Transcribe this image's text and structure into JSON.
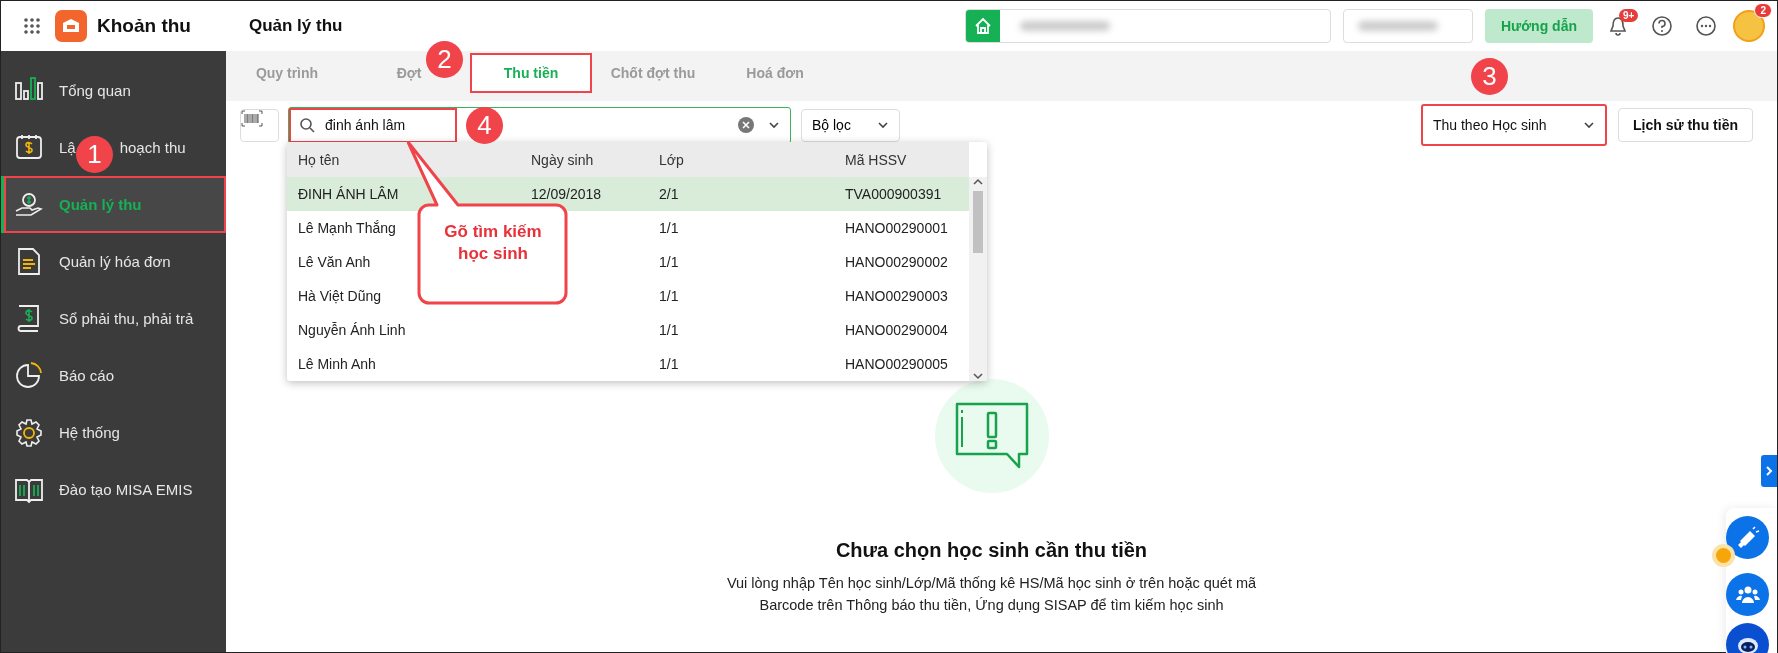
{
  "app": {
    "title": "Khoản thu",
    "page_title": "Quản lý thu"
  },
  "header": {
    "help_button": "Hướng dẫn",
    "notification_count": "9+",
    "avatar_badge": "2"
  },
  "sidebar": {
    "items": [
      {
        "label": "Tổng quan",
        "selected": false,
        "annotated": false
      },
      {
        "label": "Lậ",
        "label_rest": "hoạch thu",
        "selected": false,
        "annotated": false
      },
      {
        "label": "Quản lý thu",
        "selected": true,
        "annotated": true
      },
      {
        "label": "Quản lý hóa đơn",
        "selected": false,
        "annotated": false
      },
      {
        "label": "Sổ phải thu, phải trả",
        "selected": false,
        "annotated": false
      },
      {
        "label": "Báo cáo",
        "selected": false,
        "annotated": false
      },
      {
        "label": "Hệ thống",
        "selected": false,
        "annotated": false
      },
      {
        "label": "Đào tạo MISA EMIS",
        "selected": false,
        "annotated": false
      }
    ]
  },
  "tabs": [
    {
      "label": "Quy trình",
      "selected": false,
      "annotated": false
    },
    {
      "label": "Đợt",
      "selected": false,
      "annotated": false
    },
    {
      "label": "Thu tiền",
      "selected": true,
      "annotated": true
    },
    {
      "label": "Chốt đợt thu",
      "selected": false,
      "annotated": false
    },
    {
      "label": "Hoá đơn",
      "selected": false,
      "annotated": false
    }
  ],
  "toolbar": {
    "search": {
      "value": "đinh ánh lâm",
      "annotated": true
    },
    "filter": "Bộ lọc",
    "mode_select": {
      "value": "Thu theo Học sinh",
      "annotated": true
    },
    "history_button": "Lịch sử thu tiền"
  },
  "results": {
    "columns": [
      "Họ tên",
      "Ngày sinh",
      "Lớp",
      "Mã HSSV"
    ],
    "rows": [
      {
        "cells": [
          "ĐINH ÁNH LÂM",
          "12/09/2018",
          "2/1",
          "TVA000900391"
        ],
        "selected": true
      },
      {
        "cells": [
          "Lê Mạnh Thắng",
          "",
          "1/1",
          "HANO00290001"
        ],
        "selected": false
      },
      {
        "cells": [
          "Lê Văn Anh",
          "",
          "1/1",
          "HANO00290002"
        ],
        "selected": false
      },
      {
        "cells": [
          "Hà Việt Dũng",
          "",
          "1/1",
          "HANO00290003"
        ],
        "selected": false
      },
      {
        "cells": [
          "Nguyễn Ánh Linh",
          "",
          "1/1",
          "HANO00290004"
        ],
        "selected": false
      },
      {
        "cells": [
          "Lê Minh Anh",
          "",
          "1/1",
          "HANO00290005"
        ],
        "selected": false
      }
    ]
  },
  "empty_state": {
    "title": "Chưa chọn học sinh cần thu tiền",
    "text": "Vui lòng nhập Tên học sinh/Lớp/Mã thống kê HS/Mã học sinh ở trên hoặc quét mã\nBarcode trên Thông báo thu tiền, Ứng dụng SISAP để tìm kiếm học sinh"
  },
  "annotations": {
    "markers": [
      "1",
      "2",
      "3",
      "4"
    ],
    "callout": "Gõ tìm kiếm\nhọc sinh"
  }
}
